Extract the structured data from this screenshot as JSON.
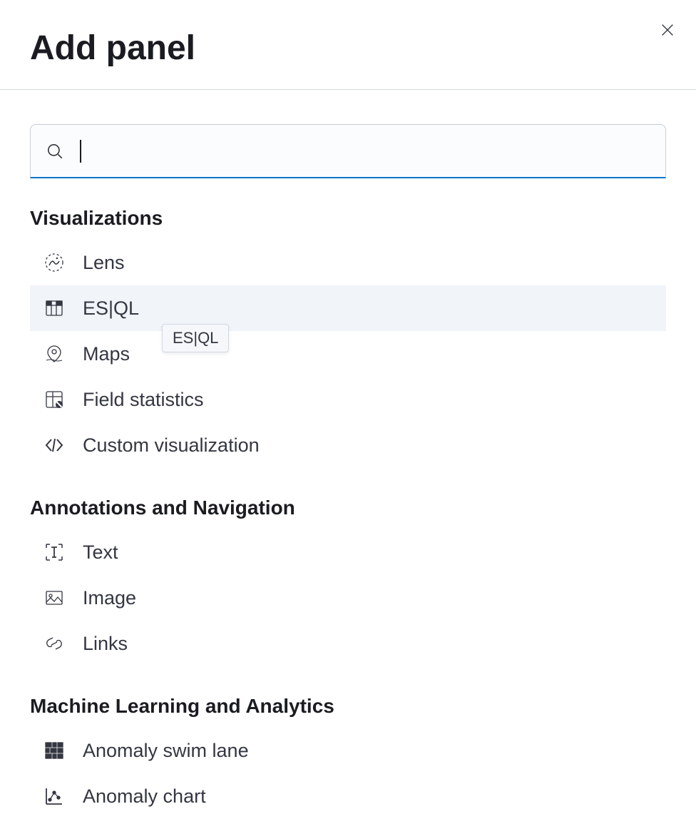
{
  "header": {
    "title": "Add panel"
  },
  "search": {
    "placeholder": ""
  },
  "tooltip": {
    "text": "ES|QL"
  },
  "groups": [
    {
      "title": "Visualizations",
      "items": [
        {
          "label": "Lens",
          "icon": "lens",
          "hovered": false
        },
        {
          "label": "ES|QL",
          "icon": "esql",
          "hovered": true
        },
        {
          "label": "Maps",
          "icon": "maps",
          "hovered": false
        },
        {
          "label": "Field statistics",
          "icon": "fieldstats",
          "hovered": false
        },
        {
          "label": "Custom visualization",
          "icon": "code",
          "hovered": false
        }
      ]
    },
    {
      "title": "Annotations and Navigation",
      "items": [
        {
          "label": "Text",
          "icon": "text",
          "hovered": false
        },
        {
          "label": "Image",
          "icon": "image",
          "hovered": false
        },
        {
          "label": "Links",
          "icon": "link",
          "hovered": false
        }
      ]
    },
    {
      "title": "Machine Learning and Analytics",
      "items": [
        {
          "label": "Anomaly swim lane",
          "icon": "swimlane",
          "hovered": false
        },
        {
          "label": "Anomaly chart",
          "icon": "anomalychart",
          "hovered": false
        }
      ]
    }
  ]
}
